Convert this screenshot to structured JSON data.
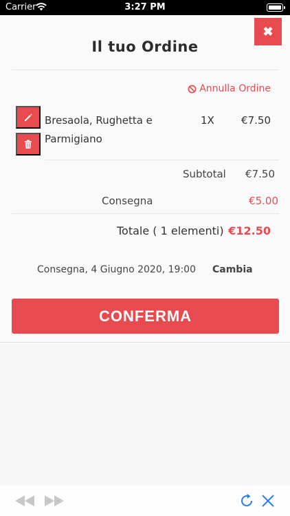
{
  "status_bar": {
    "carrier": "Carrier",
    "time": "3:27 PM"
  },
  "order": {
    "title": "Il tuo Ordine",
    "cancel_label": "Annulla Ordine",
    "items": [
      {
        "name": "Bresaola, Rughetta e Parmigiano",
        "qty": "1X",
        "price": "€7.50"
      }
    ],
    "subtotal_label": "Subtotal",
    "subtotal_value": "€7.50",
    "delivery_fee_label": "Consegna",
    "delivery_fee_value": "€5.00",
    "total_label": "Totale ( 1 elementi)",
    "total_value": "€12.50",
    "delivery_text": "Consegna, 4 Giugno 2020, 19:00",
    "change_label": "Cambia",
    "confirm_label": "CONFERMA"
  },
  "colors": {
    "accent": "#e84b4f",
    "toolbar_icons": "#2a7de1",
    "disabled": "#c8c8c8"
  },
  "icons": {
    "close": "close-icon",
    "cancel": "ban-icon",
    "edit": "pencil-icon",
    "delete": "trash-icon",
    "back": "back-icon",
    "forward": "forward-icon",
    "reload": "reload-icon",
    "dismiss": "close-icon"
  }
}
